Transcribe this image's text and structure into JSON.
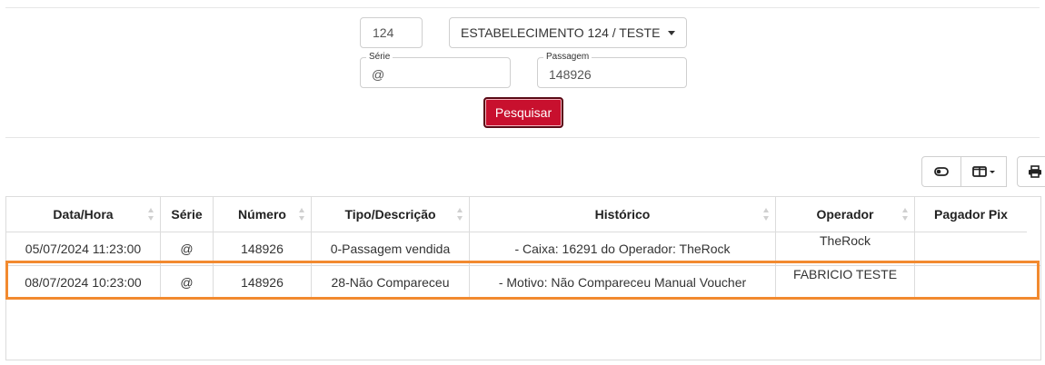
{
  "filters": {
    "code": "124",
    "establishment": "ESTABELECIMENTO 124 / TESTE",
    "serie": {
      "label": "Série",
      "value": "@"
    },
    "passagem": {
      "label": "Passagem",
      "value": "148926"
    },
    "search_label": "Pesquisar"
  },
  "toolbar": {
    "icons": [
      "toggle-icon",
      "columns-icon",
      "print-icon"
    ]
  },
  "table": {
    "columns": [
      "Data/Hora",
      "Série",
      "Número",
      "Tipo/Descrição",
      "Histórico",
      "Operador",
      "Pagador Pix"
    ],
    "rows": [
      [
        "05/07/2024 11:23:00",
        "@",
        "148926",
        "0-Passagem vendida",
        "- Caixa: 16291 do Operador: TheRock",
        "TheRock",
        ""
      ],
      [
        "08/07/2024 10:23:00",
        "@",
        "148926",
        "28-Não Compareceu",
        "- Motivo: Não Compareceu Manual Voucher",
        "FABRICIO TESTE",
        ""
      ]
    ]
  },
  "colors": {
    "primary": "#c8102e",
    "highlight": "#f28a2f"
  }
}
